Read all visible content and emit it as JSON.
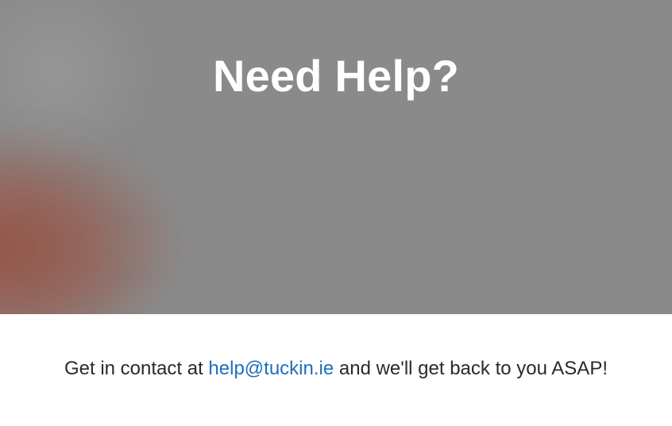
{
  "hero": {
    "title": "Need Help?"
  },
  "contact": {
    "prefix": "Get in contact at ",
    "email": "help@tuckin.ie",
    "suffix": " and we'll get back to you ASAP!"
  },
  "colors": {
    "hero_background": "#8a8a8a",
    "hero_title": "#ffffff",
    "link": "#1e6fbf",
    "body_text": "#2a2a2a"
  }
}
